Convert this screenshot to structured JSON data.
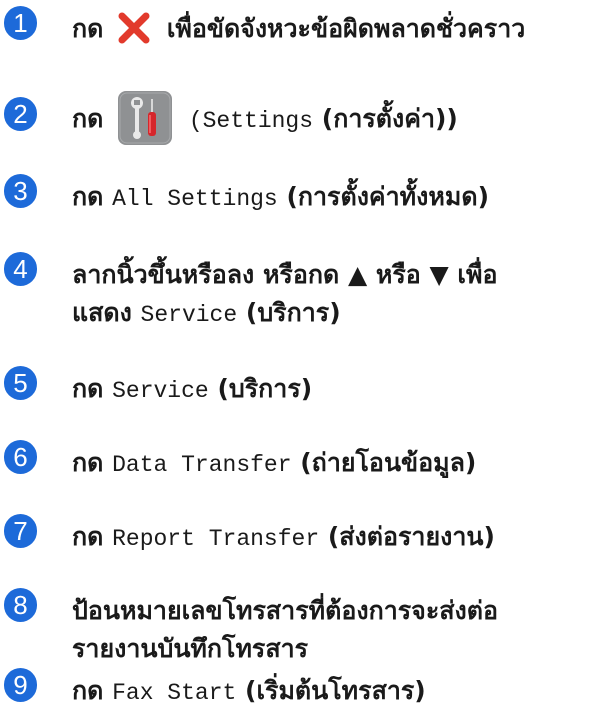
{
  "colors": {
    "accent": "#1d6ad9",
    "error_red": "#e23a2c",
    "tool_bg": "#8f9193"
  },
  "icons": {
    "step_1_icon": "close-error-icon",
    "step_2_icon": "settings-tools-icon"
  },
  "steps": [
    {
      "number": "1",
      "before": "กด",
      "after": "เพื่อขัดจังหวะข้อผิดพลาดชั่วคราว"
    },
    {
      "number": "2",
      "before": "กด",
      "mono": "(Settings",
      "after": "(การตั้งค่า))"
    },
    {
      "number": "3",
      "before": "กด",
      "mono": "All Settings",
      "after": "(การตั้งค่าทั้งหมด)"
    },
    {
      "number": "4",
      "line1": "ลากนิ้วขึ้นหรือลง หรือกด ▲ หรือ ▼ เพื่อ",
      "line2_before": "แสดง",
      "mono": "Service",
      "after": "(บริการ)"
    },
    {
      "number": "5",
      "before": "กด",
      "mono": "Service",
      "after": "(บริการ)"
    },
    {
      "number": "6",
      "before": "กด",
      "mono": "Data Transfer",
      "after": "(ถ่ายโอนข้อมูล)"
    },
    {
      "number": "7",
      "before": "กด",
      "mono": "Report Transfer",
      "after": "(ส่งต่อรายงาน)"
    },
    {
      "number": "8",
      "line1": "ป้อนหมายเลขโทรสารที่ต้องการจะส่งต่อ",
      "line2": "รายงานบันทึกโทรสาร"
    },
    {
      "number": "9",
      "before": "กด",
      "mono": "Fax Start",
      "after": "(เริ่มต้นโทรสาร)"
    }
  ]
}
